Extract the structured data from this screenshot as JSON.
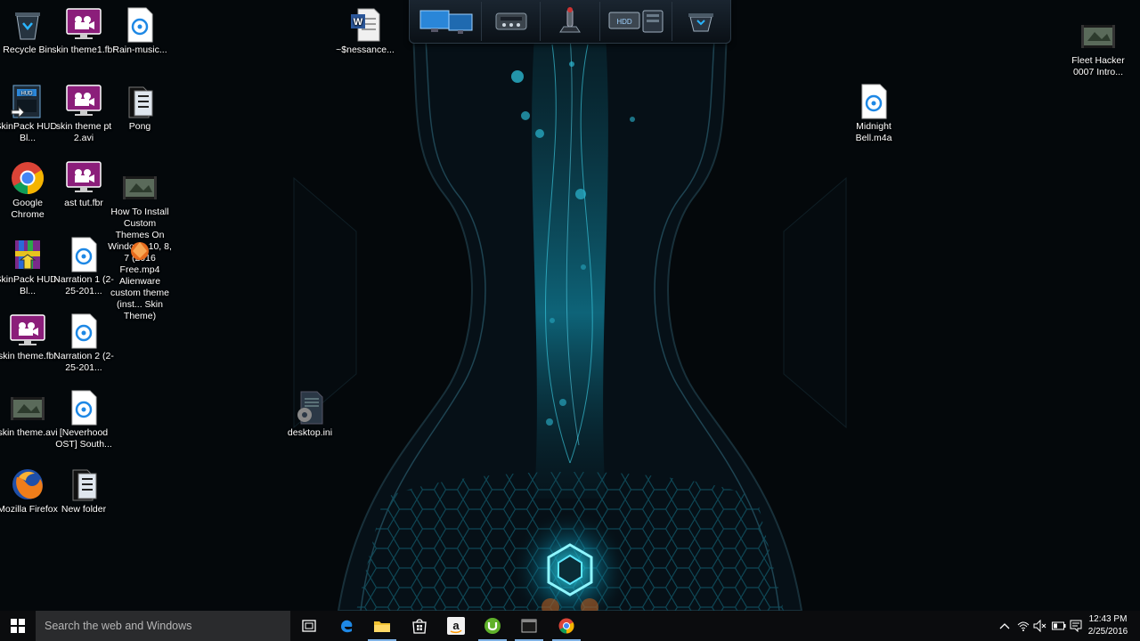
{
  "desktop_icons": [
    {
      "label": "Recycle Bin",
      "icon": "recycle-bin-icon"
    },
    {
      "label": "skin theme1.fbr",
      "icon": "video-file-icon"
    },
    {
      "label": "Rain-music...",
      "icon": "audio-file-icon"
    },
    {
      "label": "~$nessance...",
      "icon": "word-doc-icon"
    },
    {
      "label": "Fleet Hacker 0007 Intro...",
      "icon": "video-thumb-icon"
    },
    {
      "label": "SkinPack HUD-Bl...",
      "icon": "skinpack-icon"
    },
    {
      "label": "skin theme pt 2.avi",
      "icon": "video-file-icon"
    },
    {
      "label": "Pong",
      "icon": "folder-icon"
    },
    {
      "label": "Midnight Bell.m4a",
      "icon": "audio-file-icon"
    },
    {
      "label": "Google Chrome",
      "icon": "chrome-icon"
    },
    {
      "label": "ast tut.fbr",
      "icon": "video-file-icon"
    },
    {
      "label": "How To Install Custom Themes On Windows 10, 8, 7 (2016 Free.mp4",
      "icon": "video-thumb-icon"
    },
    {
      "label": "Alienware custom theme (inst... Skin Theme)",
      "icon": "alienware-icon"
    },
    {
      "label": "SkinPack HUD-Bl...",
      "icon": "winrar-icon"
    },
    {
      "label": "Narration 1 (2-25-201...",
      "icon": "audio-file-icon"
    },
    {
      "label": "skin theme.fbr",
      "icon": "video-file-icon"
    },
    {
      "label": "Narration 2 (2-25-201...",
      "icon": "audio-file-icon"
    },
    {
      "label": "desktop.ini",
      "icon": "settings-file-icon"
    },
    {
      "label": "skin theme.avi",
      "icon": "video-thumb-icon"
    },
    {
      "label": "[Neverhood OST] South...",
      "icon": "audio-file-icon"
    },
    {
      "label": "Mozilla Firefox",
      "icon": "firefox-icon"
    },
    {
      "label": "New folder",
      "icon": "folder-icon"
    }
  ],
  "dock": {
    "items": [
      "monitors-icon",
      "control-panel-icon",
      "joystick-icon",
      "hdd-icon",
      "recycle-icon"
    ]
  },
  "taskbar": {
    "search_placeholder": "Search the web and Windows",
    "pinned": [
      "task-view-icon",
      "edge-icon",
      "file-explorer-icon",
      "store-icon",
      "amazon-icon",
      "utorrent-icon",
      "terminal-icon",
      "chrome-icon"
    ],
    "tray": [
      "chevron-up-icon",
      "network-icon",
      "volume-mute-icon",
      "battery-icon",
      "keyboard-icon"
    ],
    "clock_time": "12:43 PM",
    "clock_date": "2/25/2016"
  },
  "colors": {
    "accent": "#2ee6ff",
    "taskbar": "#0b0c0e",
    "search": "#2a2b2d"
  }
}
